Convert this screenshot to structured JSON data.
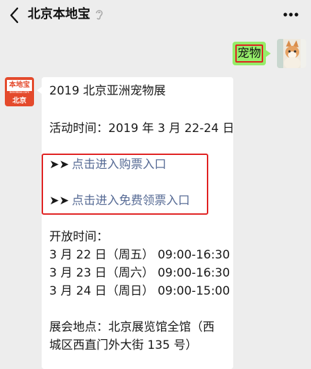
{
  "header": {
    "title": "北京本地宝"
  },
  "my_message": {
    "text": "宠物"
  },
  "oa_avatar": {
    "top_text": "本地宝",
    "sub_text": "bendibao.com",
    "bottom_text": "北京"
  },
  "message": {
    "title": "2019 北京亚洲宠物展",
    "time_line": "活动时间：2019 年 3 月 22-24 日",
    "arrow": "➤➤",
    "link_buy": "点击进入购票入口",
    "link_free": "点击进入免费领票入口",
    "open_label": "开放时间：",
    "open_times": [
      "3 月 22 日（周五） 09:00-16:30",
      "3 月 23 日（周六） 09:00-16:30",
      "3 月 24 日（周日） 09:00-15:00"
    ],
    "venue_line1": "展会地点：北京展览馆全馆（西",
    "venue_line2": "城区西直门外大街 135 号）"
  },
  "colors": {
    "link": "#576b95",
    "my_bubble": "#95ec69",
    "highlight": "#e02020",
    "brand": "#e44a2c"
  }
}
